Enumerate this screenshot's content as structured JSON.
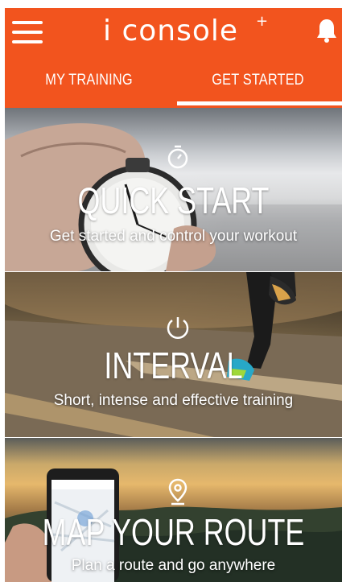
{
  "header": {
    "app_name": "i console",
    "app_name_superscript": "+",
    "menu_icon": "hamburger-menu-icon",
    "notification_icon": "bell-icon",
    "accent_color": "#f2541e"
  },
  "tabs": [
    {
      "label": "MY TRAINING",
      "selected": false
    },
    {
      "label": "GET STARTED",
      "selected": true
    }
  ],
  "cards": [
    {
      "title": "QUICK START",
      "subtitle": "Get started and control your workout",
      "icon": "stopwatch-icon"
    },
    {
      "title": "INTERVAL",
      "subtitle": "Short, intense and effective training",
      "icon": "power-timer-icon"
    },
    {
      "title": "MAP YOUR ROUTE",
      "subtitle": "Plan a route and go anywhere",
      "icon": "location-pin-icon"
    }
  ]
}
